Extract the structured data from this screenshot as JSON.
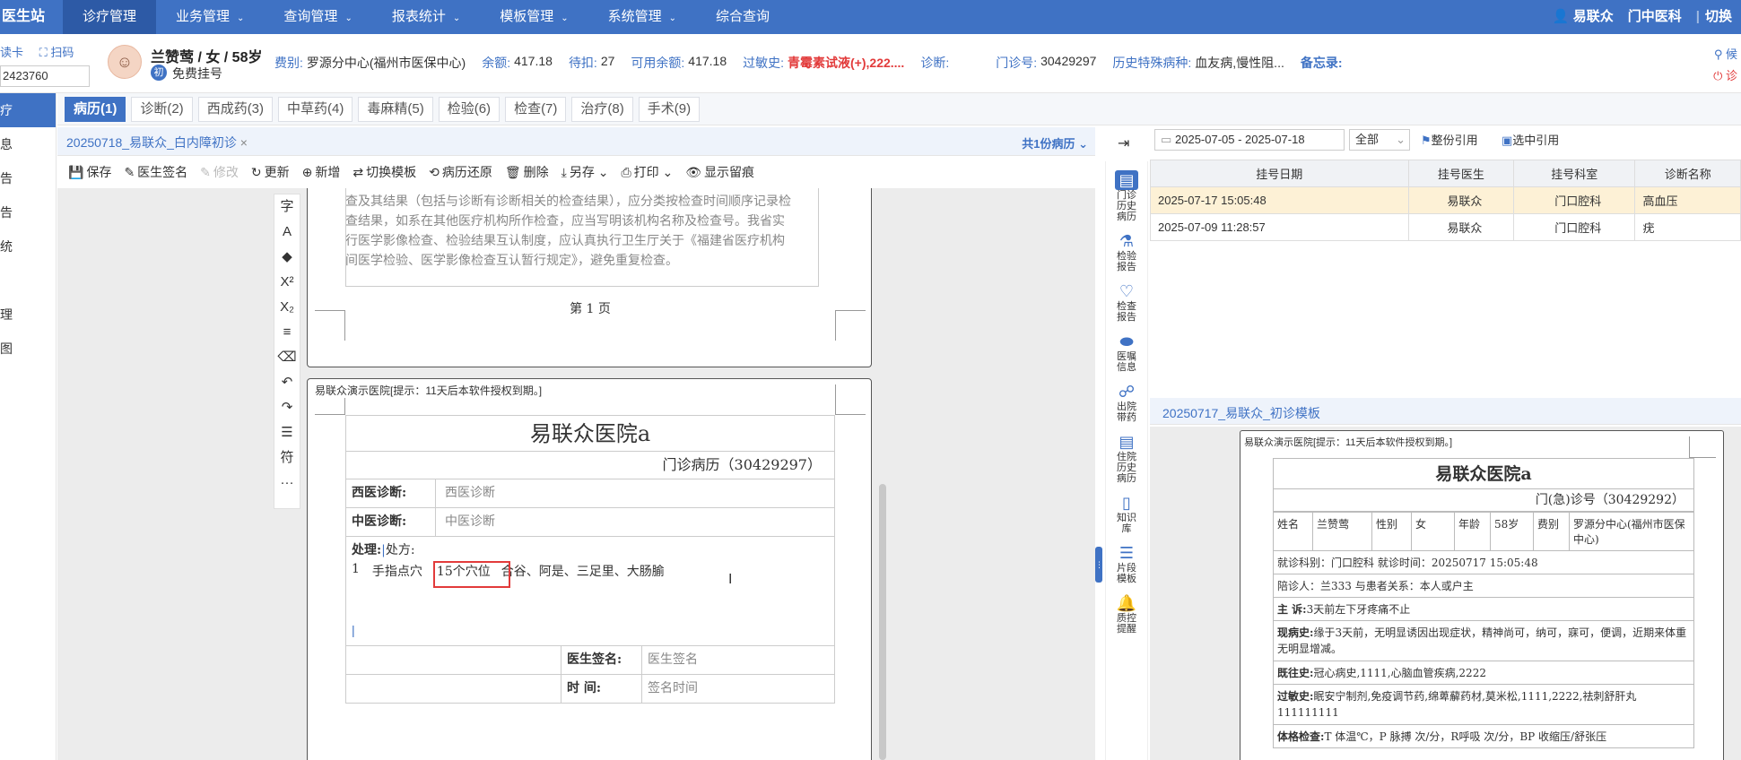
{
  "topnav": {
    "brand": "医生站",
    "menu": [
      "诊疗管理",
      "业务管理",
      "查询管理",
      "报表统计",
      "模板管理",
      "系统管理",
      "综合查询"
    ],
    "menu_has_caret": [
      false,
      true,
      true,
      true,
      true,
      true,
      false
    ],
    "user": "易联众",
    "dept": "门中医科",
    "switch": "切换"
  },
  "left_tools": {
    "read_card": "读卡",
    "scan": "扫码",
    "card_no": "2423760"
  },
  "patient": {
    "name": "兰赞莺 / 女 / 58岁",
    "badge": "初",
    "reg_type": "免费挂号",
    "fee_label": "费别:",
    "fee_value": "罗源分中心(福州市医保中心)",
    "balance_label": "余额:",
    "balance_value": "417.18",
    "pending_label": "待扣:",
    "pending_value": "27",
    "avail_label": "可用余额:",
    "avail_value": "417.18",
    "allergy_label": "过敏史:",
    "allergy_value": "青霉素试液(+),222....",
    "diag_label": "诊断:",
    "diag_value": "",
    "clinic_label": "门诊号:",
    "clinic_value": "30429297",
    "history_label": "历史特殊病种:",
    "history_value": "血友病,慢性阻...",
    "memo_label": "备忘录:"
  },
  "right_top": {
    "wait": "候",
    "exit": "诊"
  },
  "left_sidebar": [
    "疗",
    "息",
    "告",
    "告",
    "统",
    "",
    "理",
    "图"
  ],
  "tabs": [
    "病历(1)",
    "诊断(2)",
    "西成药(3)",
    "中草药(4)",
    "毒麻精(5)",
    "检验(6)",
    "检查(7)",
    "治疗(8)",
    "手术(9)"
  ],
  "doc_tab": {
    "title": "20250718_易联众_白内障初诊",
    "count": "共1份病历"
  },
  "toolbar": [
    "保存",
    "医生签名",
    "修改",
    "更新",
    "新增",
    "切换模板",
    "病历还原",
    "删除",
    "另存",
    "打印",
    "显示留痕"
  ],
  "vertical_tools": [
    "字",
    "A",
    "◆",
    "X²",
    "X₂",
    "≡",
    "⌫",
    "↶",
    "↷",
    "☰",
    "符",
    "···"
  ],
  "page1": {
    "text": "查及其结果（包括与诊断有诊断相关的检查结果），应分类按检查时间顺序记录检查结果，如系在其他医疗机构所作检查，应当写明该机构名称及检查号。我省实行医学影像检查、检验结果互认制度，应认真执行卫生厅关于《福建省医疗机构间医学检验、医学影像检查互认暂行规定》，避免重复检查。",
    "page_no": "第  1  页"
  },
  "page2": {
    "notice": "易联众演示医院[提示：11天后本软件授权到期。]",
    "hospital": "易联众医院a",
    "record_title": "门诊病历（30429297）",
    "west_label": "西医诊断:",
    "west_value": "西医诊断",
    "tcm_label": "中医诊断:",
    "tcm_value": "中医诊断",
    "treat_label": "处理:",
    "rx_label": "处方:",
    "rx_line_no": "1",
    "rx_item": "手指点穴",
    "rx_count": "15个穴位",
    "rx_points": "合谷、阿是、三足里、大肠腧",
    "sign_label": "医生签名:",
    "sign_value": "医生签名",
    "time_label": "时    间:",
    "time_value": "签名时间"
  },
  "right_icons": [
    "门诊历史病历",
    "检验报告",
    "检查报告",
    "医嘱信息",
    "出院带药",
    "住院历史病历",
    "知识库",
    "片段模板",
    "质控提醒"
  ],
  "right_filter": {
    "date_range": "2025-07-05   - 2025-07-18",
    "select": "全部",
    "btn_all": "整份引用",
    "btn_sel": "选中引用"
  },
  "reg_table": {
    "headers": [
      "挂号日期",
      "挂号医生",
      "挂号科室",
      "诊断名称"
    ],
    "rows": [
      [
        "2025-07-17 15:05:48",
        "易联众",
        "门口腔科",
        "高血压"
      ],
      [
        "2025-07-09 11:28:57",
        "易联众",
        "门口腔科",
        "疣"
      ]
    ]
  },
  "preview_tab": "20250717_易联众_初诊模板",
  "preview": {
    "notice": "易联众演示医院[提示：11天后本软件授权到期。]",
    "hospital": "易联众医院a",
    "clinic_no": "门(急)诊号（30429292）",
    "name_label": "姓名",
    "name_value": "兰赞莺",
    "sex_label": "性别",
    "sex_value": "女",
    "age_label": "年龄",
    "age_value": "58岁",
    "fee_label": "费别",
    "fee_value": "罗源分中心(福州市医保中心)",
    "visit": "就诊科别：门口腔科   就诊时间：20250717 15:05:48",
    "escort": "陪诊人：兰333   与患者关系：本人或户主",
    "chief_label": "主  诉:",
    "chief_value": "3天前左下牙疼痛不止",
    "present_label": "现病史:",
    "present_value": "缘于3天前，无明显诱因出现症状，精神尚可，纳可，寐可，便调，近期来体重无明显增减。",
    "past_label": "既往史:",
    "past_value": "冠心病史,1111,心脑血管疾病,2222",
    "allergy_label": "过敏史:",
    "allergy_value": "眠安宁制剂,免疫调节药,绵萆薢药材,莫米松,1111,2222,祛刺舒肝丸111111111",
    "exam_label": "体格检查:",
    "exam_value": "T 体温℃，P 脉搏 次/分，R呼吸 次/分，BP 收缩压/舒张压"
  }
}
